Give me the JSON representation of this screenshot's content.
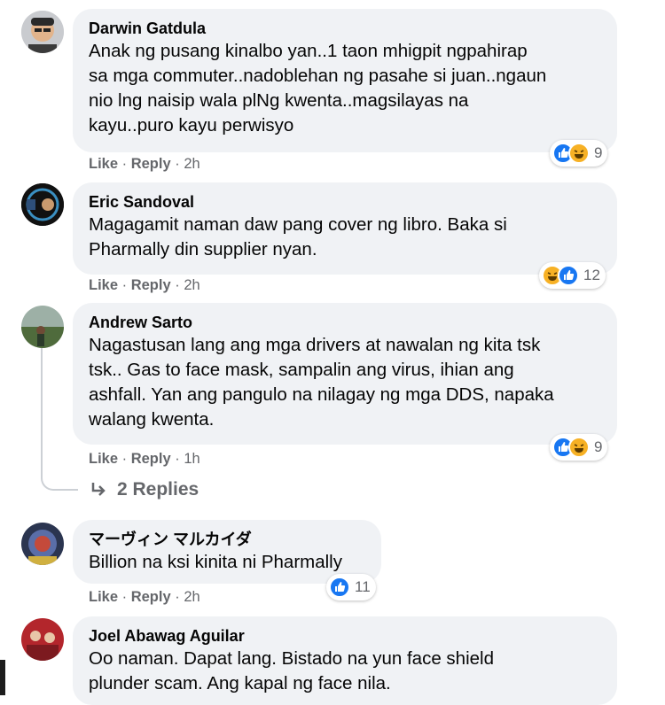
{
  "comments": [
    {
      "author": "Darwin Gatdula",
      "lines": [
        "Anak ng pusang kinalbo yan..1 taon mhigpit ngpahirap",
        "sa mga commuter..nadoblehan ng pasahe si juan..ngaun",
        "nio lng naisip wala plNg kwenta..magsilayas na",
        "kayu..puro kayu perwisyo"
      ],
      "like": "Like",
      "reply": "Reply",
      "time": "2h",
      "reactions": [
        "like",
        "haha"
      ],
      "reaction_count": "9"
    },
    {
      "author": "Eric Sandoval",
      "lines": [
        "Magagamit naman daw pang cover ng libro. Baka si",
        "Pharmally din supplier nyan."
      ],
      "like": "Like",
      "reply": "Reply",
      "time": "2h",
      "reactions": [
        "haha",
        "like"
      ],
      "reaction_count": "12"
    },
    {
      "author": "Andrew Sarto",
      "lines": [
        "Nagastusan lang ang mga drivers at nawalan ng kita tsk",
        "tsk.. Gas to face mask, sampalin ang virus, ihian ang",
        "ashfall. Yan ang pangulo na nilagay ng mga DDS, napaka",
        "walang kwenta."
      ],
      "like": "Like",
      "reply": "Reply",
      "time": "1h",
      "reactions": [
        "like",
        "haha"
      ],
      "reaction_count": "9"
    },
    {
      "author": "マーヴィン マルカイダ",
      "lines": [
        "Billion na ksi kinita ni Pharmally"
      ],
      "like": "Like",
      "reply": "Reply",
      "time": "2h",
      "reactions": [
        "like"
      ],
      "reaction_count": "11"
    },
    {
      "author": "Joel Abawag Aguilar",
      "lines": [
        "Oo naman. Dapat lang. Bistado na yun face shield",
        "plunder scam. Ang kapal ng face nila."
      ]
    }
  ],
  "replies_label": "2 Replies",
  "icons": {
    "replies": "reply-arrow-icon",
    "like": "like-reaction-icon",
    "haha": "haha-reaction-icon"
  },
  "colors": {
    "bubble": "#f0f2f5",
    "like": "#1877f2",
    "haha": "#f7b125",
    "muted": "#65676b"
  }
}
